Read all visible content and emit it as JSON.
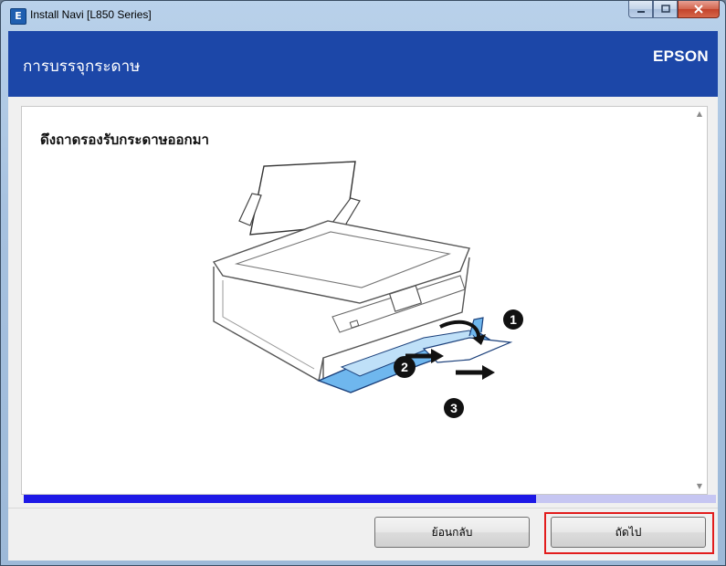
{
  "window": {
    "title": "Install Navi [L850 Series]",
    "icon": "E"
  },
  "caption_buttons": {
    "minimize": "minimize-icon",
    "maximize": "maximize-icon",
    "close": "close-icon"
  },
  "header": {
    "title": "การบรรจุกระดาษ",
    "brand": "EPSON"
  },
  "step": {
    "heading": "ดึงถาดรองรับกระดาษออกมา",
    "markers": [
      "1",
      "2",
      "3"
    ]
  },
  "progress": {
    "fraction": 0.74
  },
  "footer": {
    "back_label": "ย้อนกลับ",
    "next_label": "ถัดไป"
  },
  "colors": {
    "header_bg": "#1c47a8",
    "progress_fill": "#1d18e6",
    "progress_track": "#c6c6f2",
    "highlight": "#e21c1c",
    "tray_blue": "#6fb7ee"
  }
}
